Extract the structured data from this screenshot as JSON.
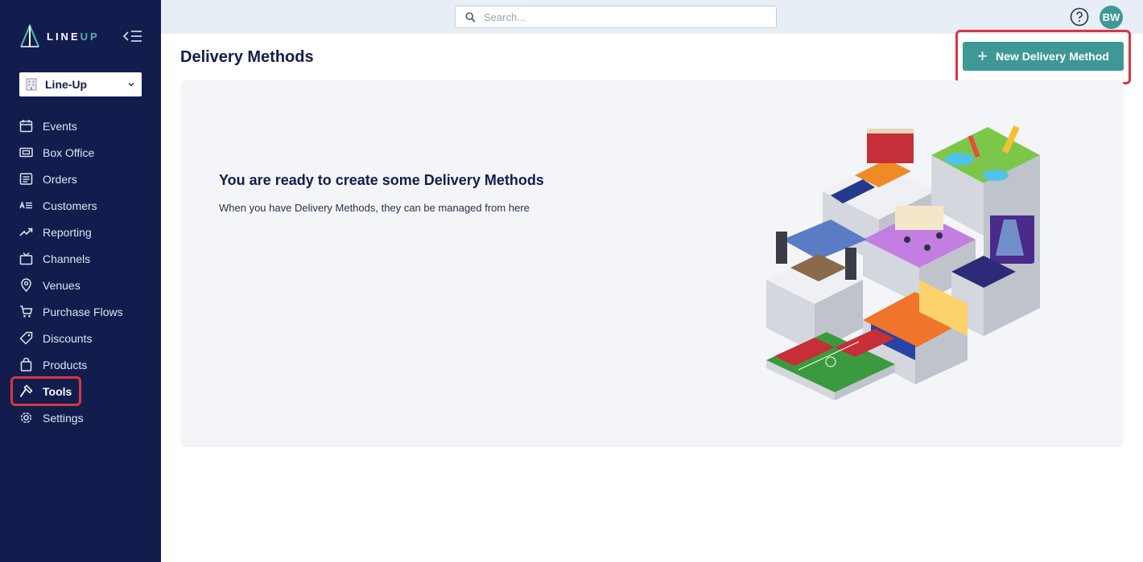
{
  "app": {
    "logo_text_main": "LINE",
    "logo_text_accent": "UP"
  },
  "sidebar": {
    "organization": "Line-Up",
    "items": [
      {
        "label": "Events",
        "icon": "calendar-icon"
      },
      {
        "label": "Box Office",
        "icon": "ticket-icon"
      },
      {
        "label": "Orders",
        "icon": "list-icon"
      },
      {
        "label": "Customers",
        "icon": "contacts-icon"
      },
      {
        "label": "Reporting",
        "icon": "trend-icon"
      },
      {
        "label": "Channels",
        "icon": "tv-icon"
      },
      {
        "label": "Venues",
        "icon": "map-pin-icon"
      },
      {
        "label": "Purchase Flows",
        "icon": "cart-icon"
      },
      {
        "label": "Discounts",
        "icon": "tag-icon"
      },
      {
        "label": "Products",
        "icon": "bag-icon"
      },
      {
        "label": "Tools",
        "icon": "hammer-icon",
        "active": true
      },
      {
        "label": "Settings",
        "icon": "gear-icon"
      }
    ]
  },
  "topbar": {
    "search_placeholder": "Search...",
    "avatar_initials": "BW"
  },
  "main": {
    "page_title": "Delivery Methods",
    "new_button_label": "New Delivery Method",
    "empty_title": "You are ready to create some Delivery Methods",
    "empty_description": "When you have Delivery Methods, they can be managed from here"
  },
  "colors": {
    "sidebar_bg": "#131d4d",
    "accent": "#3e9896",
    "highlight_border": "#d9363e",
    "topbar_bg": "#e8eef6"
  }
}
